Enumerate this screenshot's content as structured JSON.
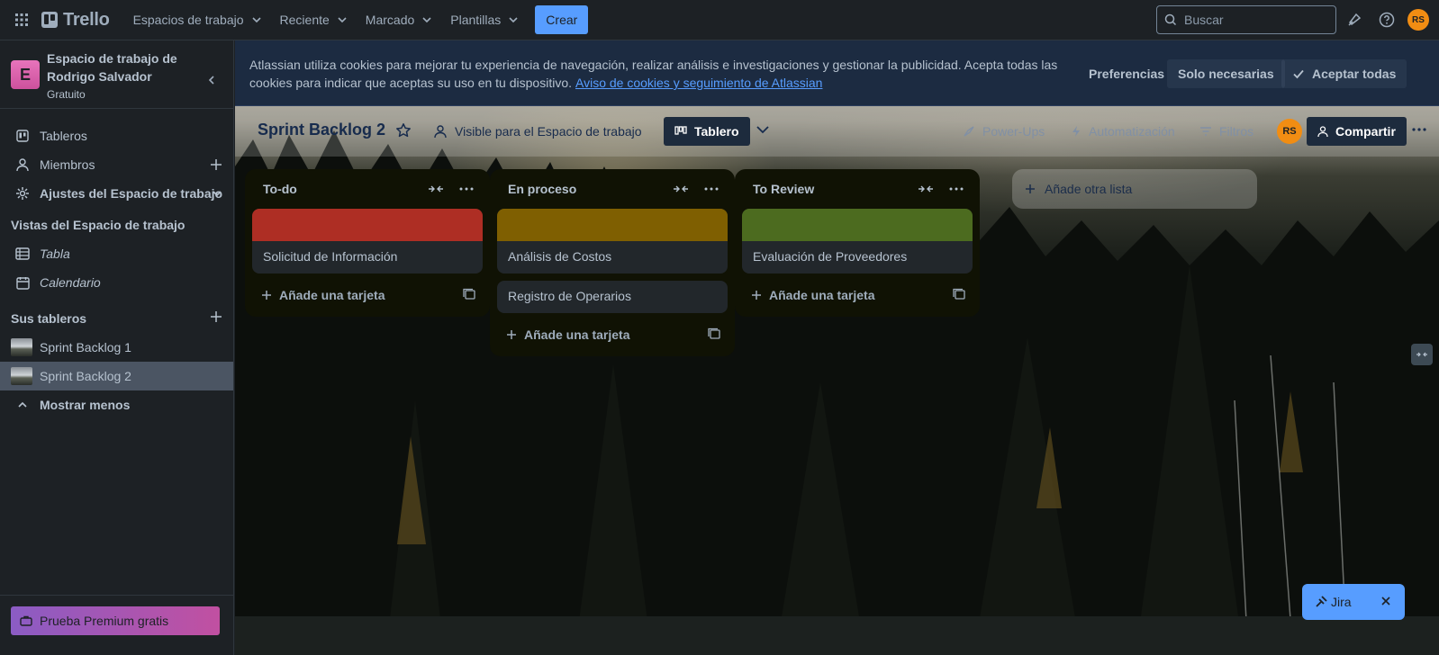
{
  "topnav": {
    "logo_text": "Trello",
    "menus": [
      "Espacios de trabajo",
      "Reciente",
      "Marcado",
      "Plantillas"
    ],
    "create_label": "Crear",
    "search_placeholder": "Buscar",
    "avatar_initials": "RS"
  },
  "sidebar": {
    "workspace_name": "Espacio de trabajo de Rodrigo Salvador",
    "workspace_initial": "E",
    "workspace_plan": "Gratuito",
    "items": {
      "boards": "Tableros",
      "members": "Miembros",
      "settings": "Ajustes del Espacio de trabajo"
    },
    "views_heading": "Vistas del Espacio de trabajo",
    "views": {
      "table": "Tabla",
      "calendar": "Calendario"
    },
    "your_boards_heading": "Sus tableros",
    "boards": [
      "Sprint Backlog 1",
      "Sprint Backlog 2"
    ],
    "show_less": "Mostrar menos",
    "premium": "Prueba Premium gratis"
  },
  "cookie_banner": {
    "text": "Atlassian utiliza cookies para mejorar tu experiencia de navegación, realizar análisis e investigaciones y gestionar la publicidad. Acepta todas las cookies para indicar que aceptas su uso en tu dispositivo.",
    "link": "Aviso de cookies y seguimiento de Atlassian",
    "preferences": "Preferencias",
    "necessary_only": "Solo necesarias",
    "accept_all": "Aceptar todas"
  },
  "board_header": {
    "title": "Sprint Backlog 2",
    "visibility": "Visible para el Espacio de trabajo",
    "view": "Tablero",
    "powerups": "Power-Ups",
    "automation": "Automatización",
    "filters": "Filtros",
    "avatar_initials": "RS",
    "share": "Compartir"
  },
  "lists": [
    {
      "title": "To-do",
      "cards": [
        {
          "title": "Solicitud de Información",
          "cover": "#ae2e24"
        }
      ],
      "add_card": "Añade una tarjeta"
    },
    {
      "title": "En proceso",
      "cards": [
        {
          "title": "Análisis de Costos",
          "cover": "#7f5f01"
        },
        {
          "title": "Registro de Operarios",
          "cover": null
        }
      ],
      "add_card": "Añade una tarjeta"
    },
    {
      "title": "To Review",
      "cards": [
        {
          "title": "Evaluación de Proveedores",
          "cover": "#4c6b1f"
        }
      ],
      "add_card": "Añade una tarjeta"
    }
  ],
  "add_list": "Añade otra lista",
  "jira": {
    "label": "Jira"
  },
  "colors": {
    "accent": "#579dff",
    "avatar": "#f18d13",
    "sidebar_bg": "#1d2125"
  }
}
